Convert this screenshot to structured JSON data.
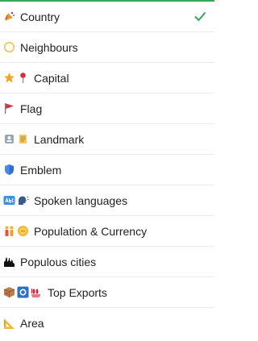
{
  "menu": {
    "items": [
      {
        "label": "Country",
        "icons": [
          "party-popper-icon"
        ],
        "selected": true
      },
      {
        "label": "Neighbours",
        "icons": [
          "compass-icon"
        ]
      },
      {
        "label": "Capital",
        "icons": [
          "star-icon",
          "pin-icon"
        ]
      },
      {
        "label": "Flag",
        "icons": [
          "red-flag-icon"
        ]
      },
      {
        "label": "Landmark",
        "icons": [
          "statue-icon",
          "scroll-icon"
        ]
      },
      {
        "label": "Emblem",
        "icons": [
          "shield-icon"
        ]
      },
      {
        "label": "Spoken languages",
        "icons": [
          "abc-icon",
          "speaking-head-icon"
        ]
      },
      {
        "label": "Population & Currency",
        "icons": [
          "people-icon",
          "coin-icon"
        ]
      },
      {
        "label": "Populous cities",
        "icons": [
          "city-icon"
        ]
      },
      {
        "label": "Top Exports",
        "icons": [
          "package-icon",
          "record-icon",
          "hundred-icon"
        ]
      },
      {
        "label": "Area",
        "icons": [
          "triangle-ruler-icon"
        ]
      }
    ],
    "check_icon": "check-icon",
    "accent_color": "#34a85a"
  }
}
